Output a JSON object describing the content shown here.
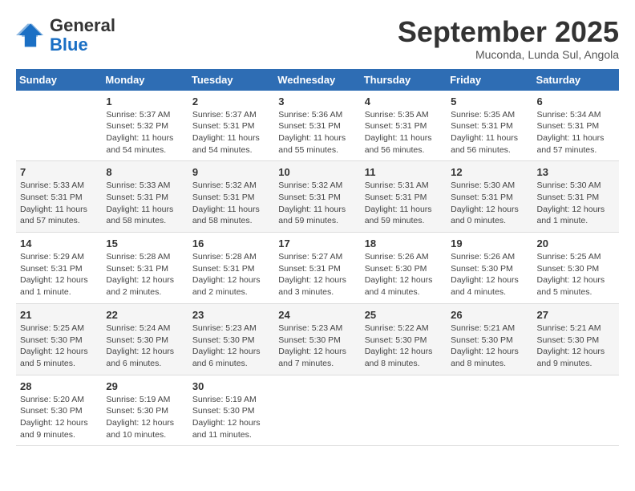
{
  "header": {
    "logo": {
      "general": "General",
      "blue": "Blue"
    },
    "title": "September 2025",
    "location": "Muconda, Lunda Sul, Angola"
  },
  "weekdays": [
    "Sunday",
    "Monday",
    "Tuesday",
    "Wednesday",
    "Thursday",
    "Friday",
    "Saturday"
  ],
  "weeks": [
    [
      {
        "day": "",
        "info": ""
      },
      {
        "day": "1",
        "info": "Sunrise: 5:37 AM\nSunset: 5:32 PM\nDaylight: 11 hours\nand 54 minutes."
      },
      {
        "day": "2",
        "info": "Sunrise: 5:37 AM\nSunset: 5:31 PM\nDaylight: 11 hours\nand 54 minutes."
      },
      {
        "day": "3",
        "info": "Sunrise: 5:36 AM\nSunset: 5:31 PM\nDaylight: 11 hours\nand 55 minutes."
      },
      {
        "day": "4",
        "info": "Sunrise: 5:35 AM\nSunset: 5:31 PM\nDaylight: 11 hours\nand 56 minutes."
      },
      {
        "day": "5",
        "info": "Sunrise: 5:35 AM\nSunset: 5:31 PM\nDaylight: 11 hours\nand 56 minutes."
      },
      {
        "day": "6",
        "info": "Sunrise: 5:34 AM\nSunset: 5:31 PM\nDaylight: 11 hours\nand 57 minutes."
      }
    ],
    [
      {
        "day": "7",
        "info": "Sunrise: 5:33 AM\nSunset: 5:31 PM\nDaylight: 11 hours\nand 57 minutes."
      },
      {
        "day": "8",
        "info": "Sunrise: 5:33 AM\nSunset: 5:31 PM\nDaylight: 11 hours\nand 58 minutes."
      },
      {
        "day": "9",
        "info": "Sunrise: 5:32 AM\nSunset: 5:31 PM\nDaylight: 11 hours\nand 58 minutes."
      },
      {
        "day": "10",
        "info": "Sunrise: 5:32 AM\nSunset: 5:31 PM\nDaylight: 11 hours\nand 59 minutes."
      },
      {
        "day": "11",
        "info": "Sunrise: 5:31 AM\nSunset: 5:31 PM\nDaylight: 11 hours\nand 59 minutes."
      },
      {
        "day": "12",
        "info": "Sunrise: 5:30 AM\nSunset: 5:31 PM\nDaylight: 12 hours\nand 0 minutes."
      },
      {
        "day": "13",
        "info": "Sunrise: 5:30 AM\nSunset: 5:31 PM\nDaylight: 12 hours\nand 1 minute."
      }
    ],
    [
      {
        "day": "14",
        "info": "Sunrise: 5:29 AM\nSunset: 5:31 PM\nDaylight: 12 hours\nand 1 minute."
      },
      {
        "day": "15",
        "info": "Sunrise: 5:28 AM\nSunset: 5:31 PM\nDaylight: 12 hours\nand 2 minutes."
      },
      {
        "day": "16",
        "info": "Sunrise: 5:28 AM\nSunset: 5:31 PM\nDaylight: 12 hours\nand 2 minutes."
      },
      {
        "day": "17",
        "info": "Sunrise: 5:27 AM\nSunset: 5:31 PM\nDaylight: 12 hours\nand 3 minutes."
      },
      {
        "day": "18",
        "info": "Sunrise: 5:26 AM\nSunset: 5:30 PM\nDaylight: 12 hours\nand 4 minutes."
      },
      {
        "day": "19",
        "info": "Sunrise: 5:26 AM\nSunset: 5:30 PM\nDaylight: 12 hours\nand 4 minutes."
      },
      {
        "day": "20",
        "info": "Sunrise: 5:25 AM\nSunset: 5:30 PM\nDaylight: 12 hours\nand 5 minutes."
      }
    ],
    [
      {
        "day": "21",
        "info": "Sunrise: 5:25 AM\nSunset: 5:30 PM\nDaylight: 12 hours\nand 5 minutes."
      },
      {
        "day": "22",
        "info": "Sunrise: 5:24 AM\nSunset: 5:30 PM\nDaylight: 12 hours\nand 6 minutes."
      },
      {
        "day": "23",
        "info": "Sunrise: 5:23 AM\nSunset: 5:30 PM\nDaylight: 12 hours\nand 6 minutes."
      },
      {
        "day": "24",
        "info": "Sunrise: 5:23 AM\nSunset: 5:30 PM\nDaylight: 12 hours\nand 7 minutes."
      },
      {
        "day": "25",
        "info": "Sunrise: 5:22 AM\nSunset: 5:30 PM\nDaylight: 12 hours\nand 8 minutes."
      },
      {
        "day": "26",
        "info": "Sunrise: 5:21 AM\nSunset: 5:30 PM\nDaylight: 12 hours\nand 8 minutes."
      },
      {
        "day": "27",
        "info": "Sunrise: 5:21 AM\nSunset: 5:30 PM\nDaylight: 12 hours\nand 9 minutes."
      }
    ],
    [
      {
        "day": "28",
        "info": "Sunrise: 5:20 AM\nSunset: 5:30 PM\nDaylight: 12 hours\nand 9 minutes."
      },
      {
        "day": "29",
        "info": "Sunrise: 5:19 AM\nSunset: 5:30 PM\nDaylight: 12 hours\nand 10 minutes."
      },
      {
        "day": "30",
        "info": "Sunrise: 5:19 AM\nSunset: 5:30 PM\nDaylight: 12 hours\nand 11 minutes."
      },
      {
        "day": "",
        "info": ""
      },
      {
        "day": "",
        "info": ""
      },
      {
        "day": "",
        "info": ""
      },
      {
        "day": "",
        "info": ""
      }
    ]
  ]
}
